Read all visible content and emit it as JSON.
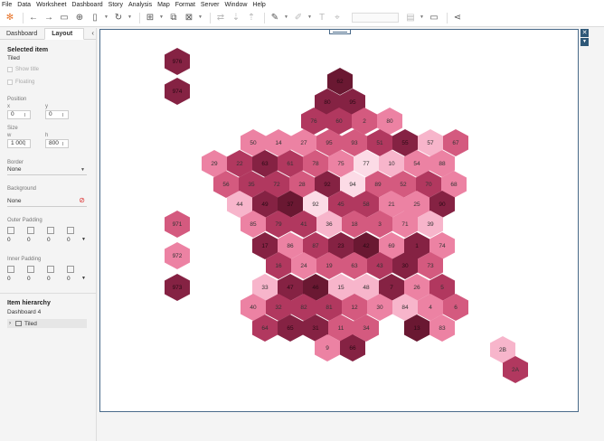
{
  "menu": [
    "File",
    "Data",
    "Worksheet",
    "Dashboard",
    "Story",
    "Analysis",
    "Map",
    "Format",
    "Server",
    "Window",
    "Help"
  ],
  "toolbar_icons": [
    "tableau-logo-icon",
    "undo-icon",
    "redo-icon",
    "save-icon",
    "new-datasource-icon",
    "pause-icon",
    "refresh-icon",
    "new-worksheet-icon",
    "duplicate-icon",
    "clear-icon",
    "swap-icon",
    "sort-asc-icon",
    "sort-desc-icon",
    "highlight-icon",
    "group-icon",
    "label-icon",
    "fix-axes-icon",
    "fit-dropdown",
    "show-cards-icon",
    "presentation-icon",
    "share-icon"
  ],
  "sidebar": {
    "tabs": [
      "Dashboard",
      "Layout"
    ],
    "selected_item_heading": "Selected item",
    "selected_item_value": "Tiled",
    "show_title": "Show title",
    "floating": "Floating",
    "position_label": "Position",
    "x_label": "x",
    "y_label": "y",
    "x_value": "0",
    "y_value": "0",
    "size_label": "Size",
    "w_label": "w",
    "h_label": "h",
    "w_value": "1 000",
    "h_value": "800",
    "border_label": "Border",
    "border_value": "None",
    "background_label": "Background",
    "background_value": "None",
    "outer_padding_label": "Outer Padding",
    "outer_padding": [
      "0",
      "0",
      "0",
      "0"
    ],
    "inner_padding_label": "Inner Padding",
    "inner_padding": [
      "0",
      "0",
      "0",
      "0"
    ],
    "hierarchy_heading": "Item hierarchy",
    "hierarchy_dashboard": "Dashboard 4",
    "hierarchy_item": "Tiled"
  },
  "colors": {
    "c1": "#f7b5cb",
    "c2": "#ec82a3",
    "c3": "#d45a7f",
    "c4": "#b1385f",
    "c5": "#852243",
    "c6": "#6a1832",
    "c7": "#fcdbe6"
  },
  "hexes": [
    {
      "label": "976",
      "c": "c5"
    },
    {
      "label": "974",
      "c": "c5"
    },
    {
      "label": "62",
      "c": "c6"
    },
    {
      "label": "80",
      "c": "c5"
    },
    {
      "label": "95",
      "c": "c5"
    },
    {
      "label": "76",
      "c": "c4"
    },
    {
      "label": "60",
      "c": "c4"
    },
    {
      "label": "2",
      "c": "c3"
    },
    {
      "label": "80",
      "c": "c2"
    },
    {
      "label": "50",
      "c": "c2"
    },
    {
      "label": "14",
      "c": "c2"
    },
    {
      "label": "27",
      "c": "c2"
    },
    {
      "label": "95",
      "c": "c3"
    },
    {
      "label": "93",
      "c": "c3"
    },
    {
      "label": "51",
      "c": "c4"
    },
    {
      "label": "55",
      "c": "c5"
    },
    {
      "label": "57",
      "c": "c1"
    },
    {
      "label": "67",
      "c": "c3"
    },
    {
      "label": "29",
      "c": "c2"
    },
    {
      "label": "22",
      "c": "c4"
    },
    {
      "label": "63",
      "c": "c5"
    },
    {
      "label": "61",
      "c": "c4"
    },
    {
      "label": "78",
      "c": "c3"
    },
    {
      "label": "75",
      "c": "c2"
    },
    {
      "label": "77",
      "c": "c7"
    },
    {
      "label": "10",
      "c": "c1"
    },
    {
      "label": "54",
      "c": "c2"
    },
    {
      "label": "88",
      "c": "c2"
    },
    {
      "label": "56",
      "c": "c3"
    },
    {
      "label": "35",
      "c": "c4"
    },
    {
      "label": "72",
      "c": "c4"
    },
    {
      "label": "28",
      "c": "c3"
    },
    {
      "label": "92",
      "c": "c5"
    },
    {
      "label": "94",
      "c": "c7"
    },
    {
      "label": "89",
      "c": "c3"
    },
    {
      "label": "52",
      "c": "c3"
    },
    {
      "label": "70",
      "c": "c4"
    },
    {
      "label": "68",
      "c": "c2"
    },
    {
      "label": "44",
      "c": "c1"
    },
    {
      "label": "49",
      "c": "c5"
    },
    {
      "label": "37",
      "c": "c6"
    },
    {
      "label": "92",
      "c": "c7"
    },
    {
      "label": "45",
      "c": "c4"
    },
    {
      "label": "58",
      "c": "c4"
    },
    {
      "label": "21",
      "c": "c2"
    },
    {
      "label": "25",
      "c": "c2"
    },
    {
      "label": "90",
      "c": "c5"
    },
    {
      "label": "971",
      "c": "c3"
    },
    {
      "label": "85",
      "c": "c2"
    },
    {
      "label": "79",
      "c": "c4"
    },
    {
      "label": "41",
      "c": "c4"
    },
    {
      "label": "36",
      "c": "c1"
    },
    {
      "label": "18",
      "c": "c3"
    },
    {
      "label": "3",
      "c": "c3"
    },
    {
      "label": "71",
      "c": "c2"
    },
    {
      "label": "39",
      "c": "c1"
    },
    {
      "label": "972",
      "c": "c2"
    },
    {
      "label": "17",
      "c": "c5"
    },
    {
      "label": "86",
      "c": "c2"
    },
    {
      "label": "87",
      "c": "c4"
    },
    {
      "label": "23",
      "c": "c5"
    },
    {
      "label": "42",
      "c": "c6"
    },
    {
      "label": "69",
      "c": "c2"
    },
    {
      "label": "1",
      "c": "c5"
    },
    {
      "label": "74",
      "c": "c2"
    },
    {
      "label": "16",
      "c": "c4"
    },
    {
      "label": "24",
      "c": "c2"
    },
    {
      "label": "19",
      "c": "c3"
    },
    {
      "label": "63",
      "c": "c3"
    },
    {
      "label": "43",
      "c": "c4"
    },
    {
      "label": "30",
      "c": "c5"
    },
    {
      "label": "73",
      "c": "c3"
    },
    {
      "label": "973",
      "c": "c5"
    },
    {
      "label": "33",
      "c": "c1"
    },
    {
      "label": "47",
      "c": "c5"
    },
    {
      "label": "46",
      "c": "c6"
    },
    {
      "label": "15",
      "c": "c1"
    },
    {
      "label": "48",
      "c": "c1"
    },
    {
      "label": "7",
      "c": "c5"
    },
    {
      "label": "26",
      "c": "c2"
    },
    {
      "label": "5",
      "c": "c4"
    },
    {
      "label": "40",
      "c": "c2"
    },
    {
      "label": "32",
      "c": "c4"
    },
    {
      "label": "82",
      "c": "c4"
    },
    {
      "label": "81",
      "c": "c4"
    },
    {
      "label": "12",
      "c": "c3"
    },
    {
      "label": "30",
      "c": "c2"
    },
    {
      "label": "84",
      "c": "c1"
    },
    {
      "label": "4",
      "c": "c2"
    },
    {
      "label": "6",
      "c": "c3"
    },
    {
      "label": "64",
      "c": "c4"
    },
    {
      "label": "65",
      "c": "c5"
    },
    {
      "label": "31",
      "c": "c5"
    },
    {
      "label": "11",
      "c": "c3"
    },
    {
      "label": "34",
      "c": "c3"
    },
    {
      "label": "13",
      "c": "c6"
    },
    {
      "label": "83",
      "c": "c2"
    },
    {
      "label": "9",
      "c": "c2"
    },
    {
      "label": "66",
      "c": "c5"
    },
    {
      "label": "2B",
      "c": "c1"
    },
    {
      "label": "2A",
      "c": "c4"
    }
  ]
}
